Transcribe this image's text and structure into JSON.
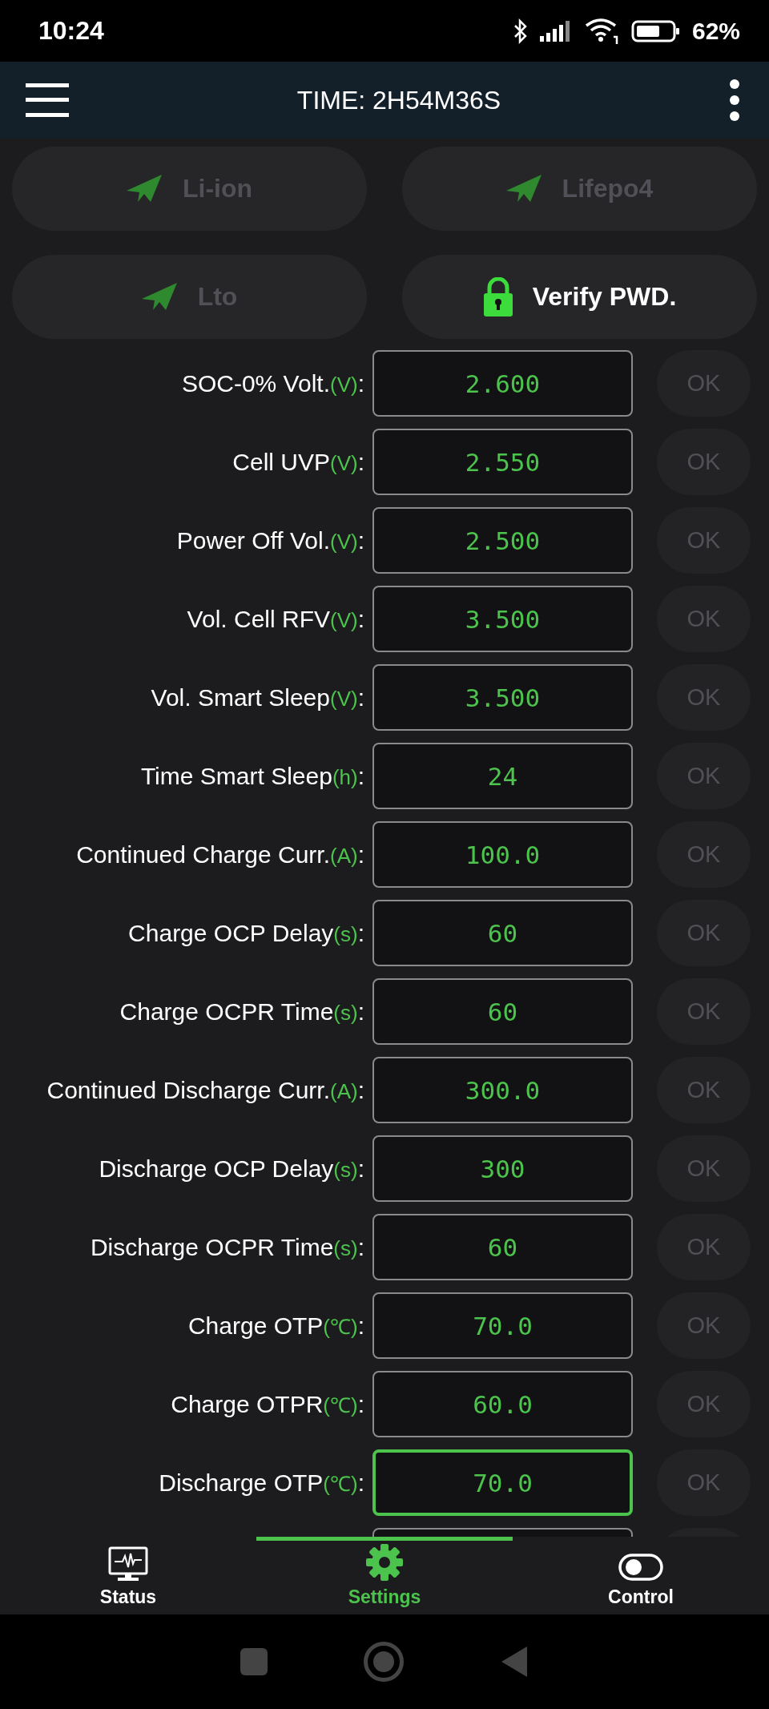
{
  "status_bar": {
    "time": "10:24",
    "battery": "62%"
  },
  "header": {
    "title": "TIME: 2H54M36S"
  },
  "battery_types": [
    {
      "label": "Li-ion",
      "kind": "type",
      "disabled": true
    },
    {
      "label": "Lifepo4",
      "kind": "type",
      "disabled": true
    },
    {
      "label": "Lto",
      "kind": "type",
      "disabled": true
    },
    {
      "label": "Verify PWD.",
      "kind": "lock",
      "disabled": false
    }
  ],
  "settings": [
    {
      "label": "SOC-0% Volt.",
      "unit": "(V)",
      "separator": ":",
      "value": "2.600",
      "focused": false,
      "button": "OK",
      "disabled": true
    },
    {
      "label": "Cell UVP",
      "unit": "(V)",
      "separator": ":",
      "value": "2.550",
      "focused": false,
      "button": "OK",
      "disabled": true
    },
    {
      "label": "Power Off Vol.",
      "unit": "(V)",
      "separator": ":",
      "value": "2.500",
      "focused": false,
      "button": "OK",
      "disabled": true
    },
    {
      "label": "Vol. Cell RFV",
      "unit": "(V)",
      "separator": ":",
      "value": "3.500",
      "focused": false,
      "button": "OK",
      "disabled": true
    },
    {
      "label": "Vol. Smart Sleep",
      "unit": "(V)",
      "separator": ":",
      "value": "3.500",
      "focused": false,
      "button": "OK",
      "disabled": true
    },
    {
      "label": "Time Smart Sleep",
      "unit": "(h)",
      "separator": ":",
      "value": "24",
      "focused": false,
      "button": "OK",
      "disabled": true
    },
    {
      "label": "Continued Charge Curr.",
      "unit": "(A)",
      "separator": ":",
      "value": "100.0",
      "focused": false,
      "button": "OK",
      "disabled": true
    },
    {
      "label": "Charge OCP Delay",
      "unit": "(s)",
      "separator": ":",
      "value": "60",
      "focused": false,
      "button": "OK",
      "disabled": true
    },
    {
      "label": "Charge OCPR Time",
      "unit": "(s)",
      "separator": ":",
      "value": "60",
      "focused": false,
      "button": "OK",
      "disabled": true
    },
    {
      "label": "Continued Discharge Curr.",
      "unit": "(A)",
      "separator": ":",
      "value": "300.0",
      "focused": false,
      "button": "OK",
      "disabled": true
    },
    {
      "label": "Discharge OCP Delay",
      "unit": "(s)",
      "separator": ":",
      "value": "300",
      "focused": false,
      "button": "OK",
      "disabled": true
    },
    {
      "label": "Discharge OCPR Time",
      "unit": "(s)",
      "separator": ":",
      "value": "60",
      "focused": false,
      "button": "OK",
      "disabled": true
    },
    {
      "label": "Charge OTP",
      "unit": "(℃)",
      "separator": ":",
      "value": "70.0",
      "focused": false,
      "button": "OK",
      "disabled": true
    },
    {
      "label": "Charge OTPR",
      "unit": "(℃)",
      "separator": ":",
      "value": "60.0",
      "focused": false,
      "button": "OK",
      "disabled": true
    },
    {
      "label": "Discharge OTP",
      "unit": "(℃)",
      "separator": ":",
      "value": "70.0",
      "focused": true,
      "button": "OK",
      "disabled": true
    }
  ],
  "bottom_nav": [
    {
      "label": "Status",
      "kind": "status",
      "selected": false
    },
    {
      "label": "Settings",
      "kind": "settings",
      "selected": true
    },
    {
      "label": "Control",
      "kind": "control",
      "selected": false
    }
  ]
}
